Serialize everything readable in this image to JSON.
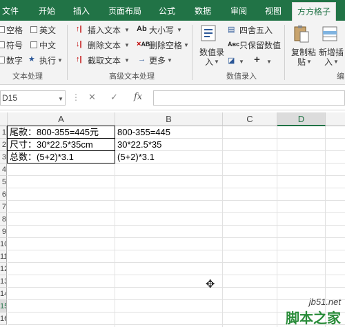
{
  "tabs": [
    {
      "label": "文件"
    },
    {
      "label": "开始"
    },
    {
      "label": "插入"
    },
    {
      "label": "页面布局"
    },
    {
      "label": "公式"
    },
    {
      "label": "数据"
    },
    {
      "label": "审阅"
    },
    {
      "label": "视图"
    },
    {
      "label": "方方格子",
      "active": true
    }
  ],
  "ribbon": {
    "text_group": {
      "items": [
        "空格",
        "英文",
        "符号",
        "中文",
        "数字",
        "执行"
      ],
      "label": "文本处理"
    },
    "advanced_group": {
      "insert_text": "插入文本",
      "delete_text": "删除文本",
      "cut_text": "截取文本",
      "case": "大小写",
      "delete_space": "删除空格",
      "more": "更多",
      "label": "高级文本处理"
    },
    "number_group": {
      "number_entry_line1": "数值录",
      "number_entry_line2": "入",
      "round": "四舍五入",
      "keep_values": "只保留数值",
      "plus": "+",
      "label": "数值录入"
    },
    "paste_group": {
      "copy_paste_line1": "复制粘",
      "copy_paste_line2": "贴",
      "new_insert_line1": "新增插",
      "new_insert_line2": "入",
      "label": "编"
    }
  },
  "formula_bar": {
    "name_box": "D15",
    "cancel": "✕",
    "confirm": "✓",
    "fx": "fx",
    "value": ""
  },
  "columns": [
    "A",
    "B",
    "C",
    "D"
  ],
  "active_column": "D",
  "rows": [
    "1",
    "2",
    "3",
    "4",
    "5",
    "6",
    "7",
    "8",
    "9",
    "10",
    "11",
    "12",
    "13",
    "14",
    "15",
    "16"
  ],
  "active_row": "15",
  "cells": {
    "A1": "尾款：800-355=445元",
    "A2": "尺寸：30*22.5*35cm",
    "A3": "总数：(5+2)*3.1",
    "B1": "800-355=445",
    "B2": "30*22.5*35",
    "B3": "(5+2)*3.1"
  },
  "watermark": {
    "site": "jb51.net",
    "brand": "脚本之家"
  },
  "colors": {
    "accent": "#217346",
    "ribbon_bg": "#f3f3f3"
  }
}
